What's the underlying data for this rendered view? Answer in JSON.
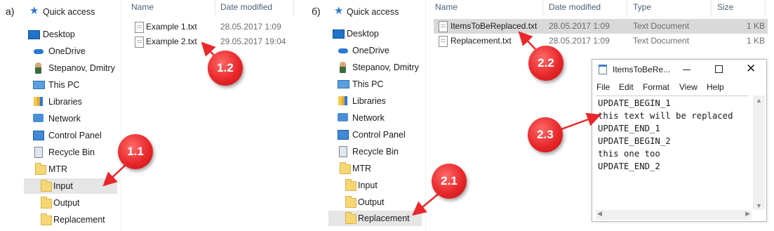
{
  "panel_a": {
    "label": "а)",
    "nav": [
      {
        "label": "Quick access",
        "icon": "star-icon"
      },
      {
        "label": "Desktop",
        "icon": "desktop-icon"
      },
      {
        "label": "OneDrive",
        "icon": "cloud-icon"
      },
      {
        "label": "Stepanov, Dmitry",
        "icon": "user-icon"
      },
      {
        "label": "This PC",
        "icon": "computer-icon"
      },
      {
        "label": "Libraries",
        "icon": "libraries-icon"
      },
      {
        "label": "Network",
        "icon": "network-icon"
      },
      {
        "label": "Control Panel",
        "icon": "control-panel-icon"
      },
      {
        "label": "Recycle Bin",
        "icon": "recycle-bin-icon"
      },
      {
        "label": "MTR",
        "icon": "folder-icon"
      },
      {
        "label": "Input",
        "icon": "folder-icon",
        "selected": true
      },
      {
        "label": "Output",
        "icon": "folder-icon"
      },
      {
        "label": "Replacement",
        "icon": "folder-icon"
      }
    ],
    "columns": {
      "name": "Name",
      "date": "Date modified"
    },
    "files": [
      {
        "name": "Example 1.txt",
        "date": "28.05.2017 1:09"
      },
      {
        "name": "Example 2.txt",
        "date": "29.05.2017 19:04"
      }
    ],
    "markers": {
      "m1": "1.1",
      "m2": "1.2"
    }
  },
  "panel_b": {
    "label": "б)",
    "nav": [
      {
        "label": "Quick access",
        "icon": "star-icon"
      },
      {
        "label": "Desktop",
        "icon": "desktop-icon"
      },
      {
        "label": "OneDrive",
        "icon": "cloud-icon"
      },
      {
        "label": "Stepanov, Dmitry",
        "icon": "user-icon"
      },
      {
        "label": "This PC",
        "icon": "computer-icon"
      },
      {
        "label": "Libraries",
        "icon": "libraries-icon"
      },
      {
        "label": "Network",
        "icon": "network-icon"
      },
      {
        "label": "Control Panel",
        "icon": "control-panel-icon"
      },
      {
        "label": "Recycle Bin",
        "icon": "recycle-bin-icon"
      },
      {
        "label": "MTR",
        "icon": "folder-icon"
      },
      {
        "label": "Input",
        "icon": "folder-icon"
      },
      {
        "label": "Output",
        "icon": "folder-icon"
      },
      {
        "label": "Replacement",
        "icon": "folder-icon",
        "selected": true
      }
    ],
    "columns": {
      "name": "Name",
      "date": "Date modified",
      "type": "Type",
      "size": "Size"
    },
    "files": [
      {
        "name": "ItemsToBeReplaced.txt",
        "date": "28.05.2017 1:09",
        "type": "Text Document",
        "size": "1 KB",
        "selected": true
      },
      {
        "name": "Replacement.txt",
        "date": "28.05.2017 1:09",
        "type": "Text Document",
        "size": "1 KB"
      }
    ],
    "markers": {
      "m1": "2.1",
      "m2": "2.2",
      "m3": "2.3"
    }
  },
  "notepad": {
    "title": "ItemsToBeRe...",
    "menu": [
      "File",
      "Edit",
      "Format",
      "View",
      "Help"
    ],
    "lines": [
      "UPDATE_BEGIN_1",
      "this text will be replaced",
      "UPDATE_END_1",
      "UPDATE_BEGIN_2",
      "this one too",
      "UPDATE_END_2"
    ]
  },
  "colors": {
    "marker": "#e8282b",
    "selection": "#e5e5e5",
    "header_text": "#4c607a"
  }
}
